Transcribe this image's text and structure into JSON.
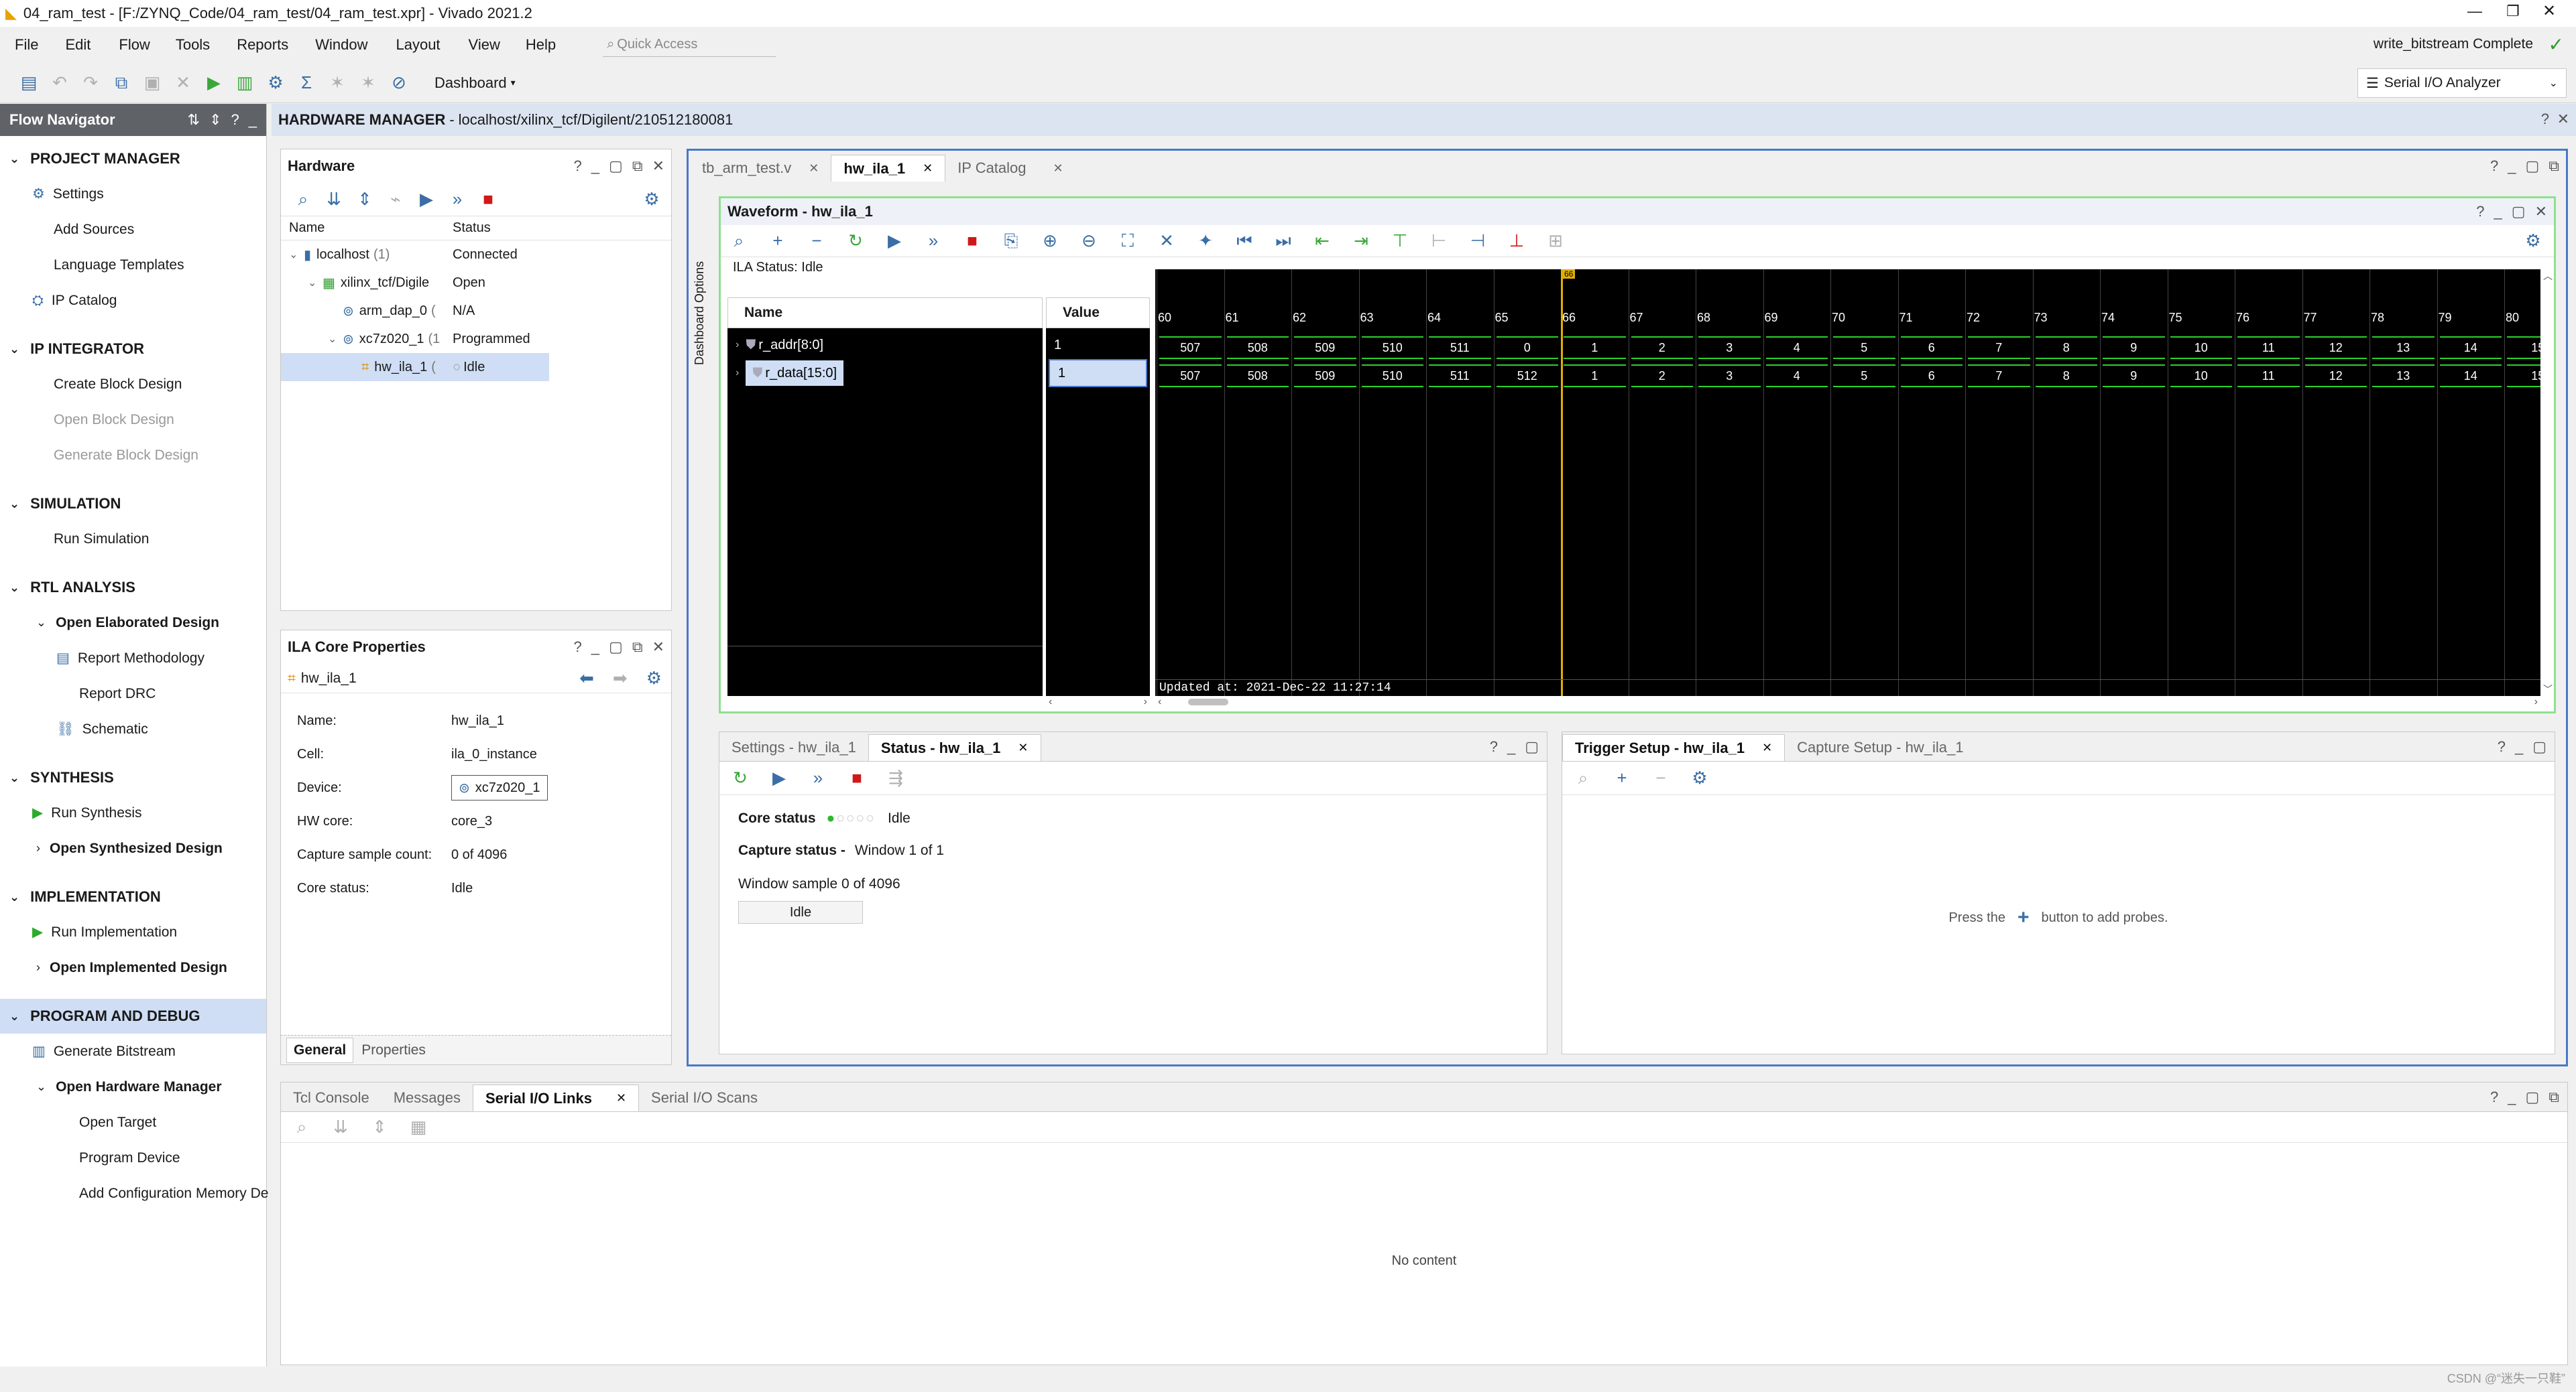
{
  "window": {
    "title": "04_ram_test - [F:/ZYNQ_Code/04_ram_test/04_ram_test.xpr] - Vivado 2021.2",
    "status": "write_bitstream Complete"
  },
  "menu": [
    "File",
    "Edit",
    "Flow",
    "Tools",
    "Reports",
    "Window",
    "Layout",
    "View",
    "Help"
  ],
  "quick_access_placeholder": "Quick Access",
  "toolbar": {
    "dashboard_label": "Dashboard",
    "layout_select": "Serial I/O Analyzer"
  },
  "flow_navigator": {
    "title": "Flow Navigator",
    "sections": [
      {
        "label": "PROJECT MANAGER",
        "items": [
          "Settings",
          "Add Sources",
          "Language Templates",
          "IP Catalog"
        ]
      },
      {
        "label": "IP INTEGRATOR",
        "items": [
          "Create Block Design",
          "Open Block Design",
          "Generate Block Design"
        ]
      },
      {
        "label": "SIMULATION",
        "items": [
          "Run Simulation"
        ]
      },
      {
        "label": "RTL ANALYSIS",
        "items": [
          "Open Elaborated Design",
          "Report Methodology",
          "Report DRC",
          "Schematic"
        ]
      },
      {
        "label": "SYNTHESIS",
        "items": [
          "Run Synthesis",
          "Open Synthesized Design"
        ]
      },
      {
        "label": "IMPLEMENTATION",
        "items": [
          "Run Implementation",
          "Open Implemented Design"
        ]
      },
      {
        "label": "PROGRAM AND DEBUG",
        "items": [
          "Generate Bitstream",
          "Open Hardware Manager",
          "Open Target",
          "Program Device",
          "Add Configuration Memory De"
        ]
      }
    ]
  },
  "hw_manager": {
    "label": "HARDWARE MANAGER",
    "path": "localhost/xilinx_tcf/Digilent/210512180081"
  },
  "hardware": {
    "title": "Hardware",
    "columns": [
      "Name",
      "Status"
    ],
    "rows": [
      {
        "name": "localhost",
        "count": "(1)",
        "status": "Connected"
      },
      {
        "name": "xilinx_tcf/Digile",
        "status": "Open"
      },
      {
        "name": "arm_dap_0",
        "count": "(",
        "status": "N/A"
      },
      {
        "name": "xc7z020_1",
        "count": "(1",
        "status": "Programmed"
      },
      {
        "name": "hw_ila_1",
        "count": "(",
        "status": "Idle"
      }
    ]
  },
  "ila_props": {
    "title": "ILA Core Properties",
    "core": "hw_ila_1",
    "fields": [
      {
        "label": "Name:",
        "value": "hw_ila_1"
      },
      {
        "label": "Cell:",
        "value": "ila_0_instance"
      },
      {
        "label": "Device:",
        "value": "xc7z020_1"
      },
      {
        "label": "HW core:",
        "value": "core_3"
      },
      {
        "label": "Capture sample count:",
        "value": "0 of 4096"
      },
      {
        "label": "Core status:",
        "value": "Idle"
      }
    ],
    "tabs": [
      "General",
      "Properties"
    ]
  },
  "editor_tabs": [
    "tb_arm_test.v",
    "hw_ila_1",
    "IP Catalog"
  ],
  "dashboard_options": "Dashboard Options",
  "waveform": {
    "title": "Waveform - hw_ila_1",
    "ila_status": "ILA Status:  Idle",
    "name_header": "Name",
    "value_header": "Value",
    "signals": [
      {
        "name": "r_addr[8:0]",
        "value": "1",
        "cells": [
          "507",
          "508",
          "509",
          "510",
          "511",
          "0",
          "1",
          "2",
          "3",
          "4",
          "5",
          "6",
          "7",
          "8",
          "9",
          "10",
          "11",
          "12",
          "13",
          "14",
          "15"
        ]
      },
      {
        "name": "r_data[15:0]",
        "value": "1",
        "cells": [
          "507",
          "508",
          "509",
          "510",
          "511",
          "512",
          "1",
          "2",
          "3",
          "4",
          "5",
          "6",
          "7",
          "8",
          "9",
          "10",
          "11",
          "12",
          "13",
          "14",
          "15"
        ]
      }
    ],
    "ticks": [
      "60",
      "61",
      "62",
      "63",
      "64",
      "65",
      "66",
      "67",
      "68",
      "69",
      "70",
      "71",
      "72",
      "73",
      "74",
      "75",
      "76",
      "77",
      "78",
      "79",
      "80"
    ],
    "cursor_label": "66",
    "updated": "Updated at: 2021-Dec-22 11:27:14"
  },
  "status_panel": {
    "tabs": [
      "Settings - hw_ila_1",
      "Status - hw_ila_1"
    ],
    "core_status_label": "Core status",
    "core_status_value": "Idle",
    "capture_status_label": "Capture status -",
    "capture_status_value": "Window 1 of 1",
    "window_sample": "Window sample 0 of 4096",
    "idle_button": "Idle"
  },
  "trigger_panel": {
    "tabs": [
      "Trigger Setup - hw_ila_1",
      "Capture Setup - hw_ila_1"
    ],
    "hint_before": "Press the",
    "hint_after": "button to add probes."
  },
  "console": {
    "tabs": [
      "Tcl Console",
      "Messages",
      "Serial I/O Links",
      "Serial I/O Scans"
    ],
    "empty": "No content"
  },
  "watermark": "CSDN @“迷失一只鞋”"
}
